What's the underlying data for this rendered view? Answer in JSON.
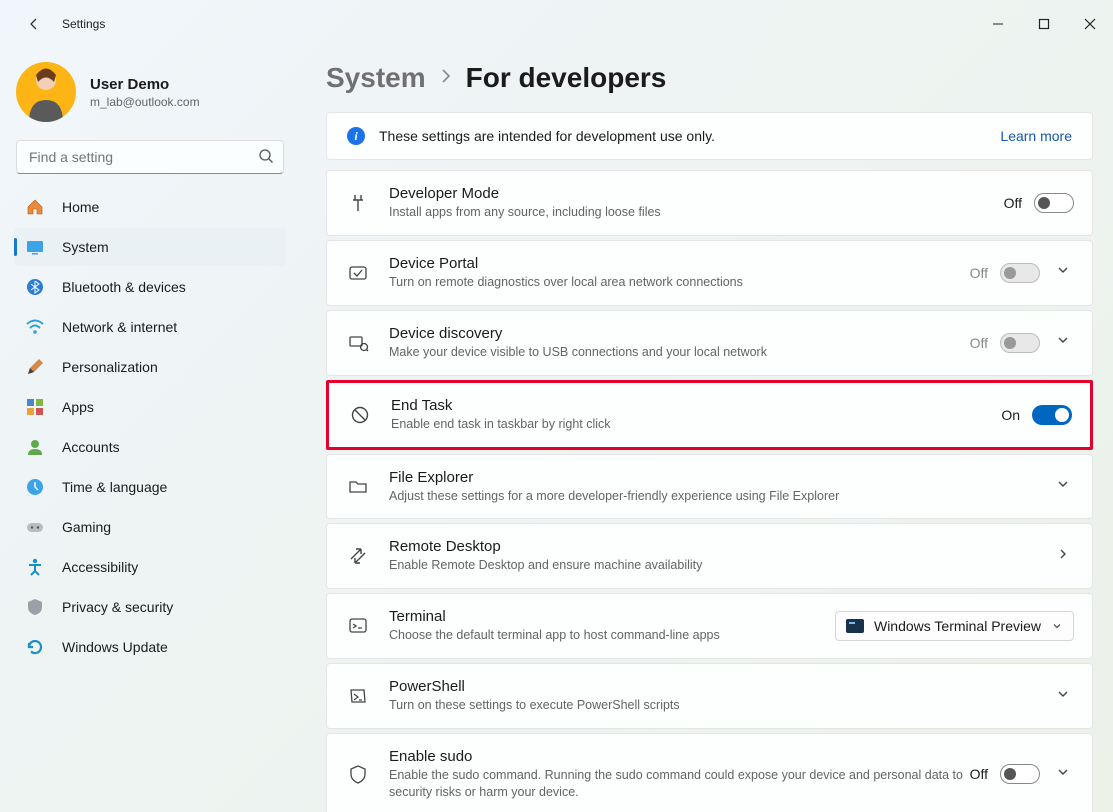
{
  "window": {
    "title": "Settings"
  },
  "user": {
    "name": "User Demo",
    "email": "m_lab@outlook.com"
  },
  "search": {
    "placeholder": "Find a setting"
  },
  "nav": {
    "home": "Home",
    "system": "System",
    "bluetooth": "Bluetooth & devices",
    "network": "Network & internet",
    "personalization": "Personalization",
    "apps": "Apps",
    "accounts": "Accounts",
    "time": "Time & language",
    "gaming": "Gaming",
    "accessibility": "Accessibility",
    "privacy": "Privacy & security",
    "update": "Windows Update"
  },
  "breadcrumb": {
    "parent": "System",
    "current": "For developers"
  },
  "infobar": {
    "text": "These settings are intended for development use only.",
    "learn": "Learn more"
  },
  "cards": {
    "devmode": {
      "title": "Developer Mode",
      "desc": "Install apps from any source, including loose files",
      "state": "Off"
    },
    "portal": {
      "title": "Device Portal",
      "desc": "Turn on remote diagnostics over local area network connections",
      "state": "Off"
    },
    "discovery": {
      "title": "Device discovery",
      "desc": "Make your device visible to USB connections and your local network",
      "state": "Off"
    },
    "endtask": {
      "title": "End Task",
      "desc": "Enable end task in taskbar by right click",
      "state": "On"
    },
    "explorer": {
      "title": "File Explorer",
      "desc": "Adjust these settings for a more developer-friendly experience using File Explorer"
    },
    "remote": {
      "title": "Remote Desktop",
      "desc": "Enable Remote Desktop and ensure machine availability"
    },
    "terminal": {
      "title": "Terminal",
      "desc": "Choose the default terminal app to host command-line apps",
      "selected": "Windows Terminal Preview"
    },
    "powershell": {
      "title": "PowerShell",
      "desc": "Turn on these settings to execute PowerShell scripts"
    },
    "sudo": {
      "title": "Enable sudo",
      "desc": "Enable the sudo command. Running the sudo command could expose your device and personal data to security risks or harm your device.",
      "state": "Off"
    }
  }
}
